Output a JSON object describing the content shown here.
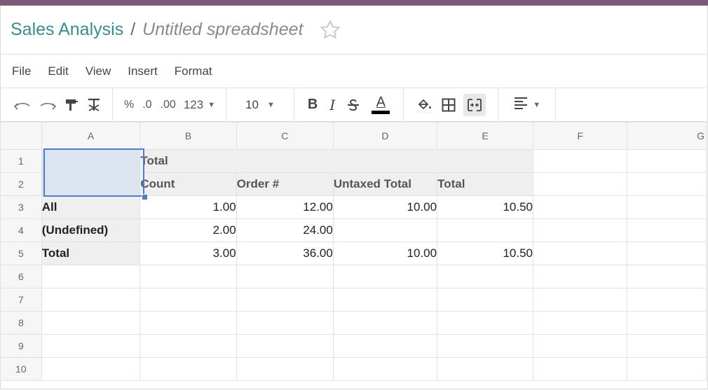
{
  "breadcrumb": {
    "parent": "Sales Analysis",
    "separator": "/",
    "current": "Untitled spreadsheet"
  },
  "menus": [
    "File",
    "Edit",
    "View",
    "Insert",
    "Format"
  ],
  "toolbar": {
    "percent": "%",
    "decrease_decimal": ".0",
    "increase_decimal": ".00",
    "more_formats": "123",
    "font_size": "10",
    "bold": "B",
    "italic": "I",
    "text_color": "A"
  },
  "columns": [
    "A",
    "B",
    "C",
    "D",
    "E",
    "F",
    "G"
  ],
  "rows": [
    {
      "n": "1",
      "cells": [
        "",
        "Total",
        "",
        "",
        "",
        "",
        ""
      ]
    },
    {
      "n": "2",
      "cells": [
        "",
        "Count",
        "Order #",
        "Untaxed Total",
        "Total",
        "",
        ""
      ]
    },
    {
      "n": "3",
      "cells": [
        "All",
        "1.00",
        "12.00",
        "10.00",
        "10.50",
        "",
        ""
      ]
    },
    {
      "n": "4",
      "cells": [
        "(Undefined)",
        "2.00",
        "24.00",
        "",
        "",
        "",
        ""
      ]
    },
    {
      "n": "5",
      "cells": [
        "Total",
        "3.00",
        "36.00",
        "10.00",
        "10.50",
        "",
        ""
      ]
    },
    {
      "n": "6",
      "cells": [
        "",
        "",
        "",
        "",
        "",
        "",
        ""
      ]
    },
    {
      "n": "7",
      "cells": [
        "",
        "",
        "",
        "",
        "",
        "",
        ""
      ]
    },
    {
      "n": "8",
      "cells": [
        "",
        "",
        "",
        "",
        "",
        "",
        ""
      ]
    },
    {
      "n": "9",
      "cells": [
        "",
        "",
        "",
        "",
        "",
        "",
        ""
      ]
    },
    {
      "n": "10",
      "cells": [
        "",
        "",
        "",
        "",
        "",
        "",
        ""
      ]
    }
  ],
  "colors": {
    "accent": "#3d8a8a",
    "topbar": "#7c5a75",
    "selection": "#4a7fc8"
  }
}
